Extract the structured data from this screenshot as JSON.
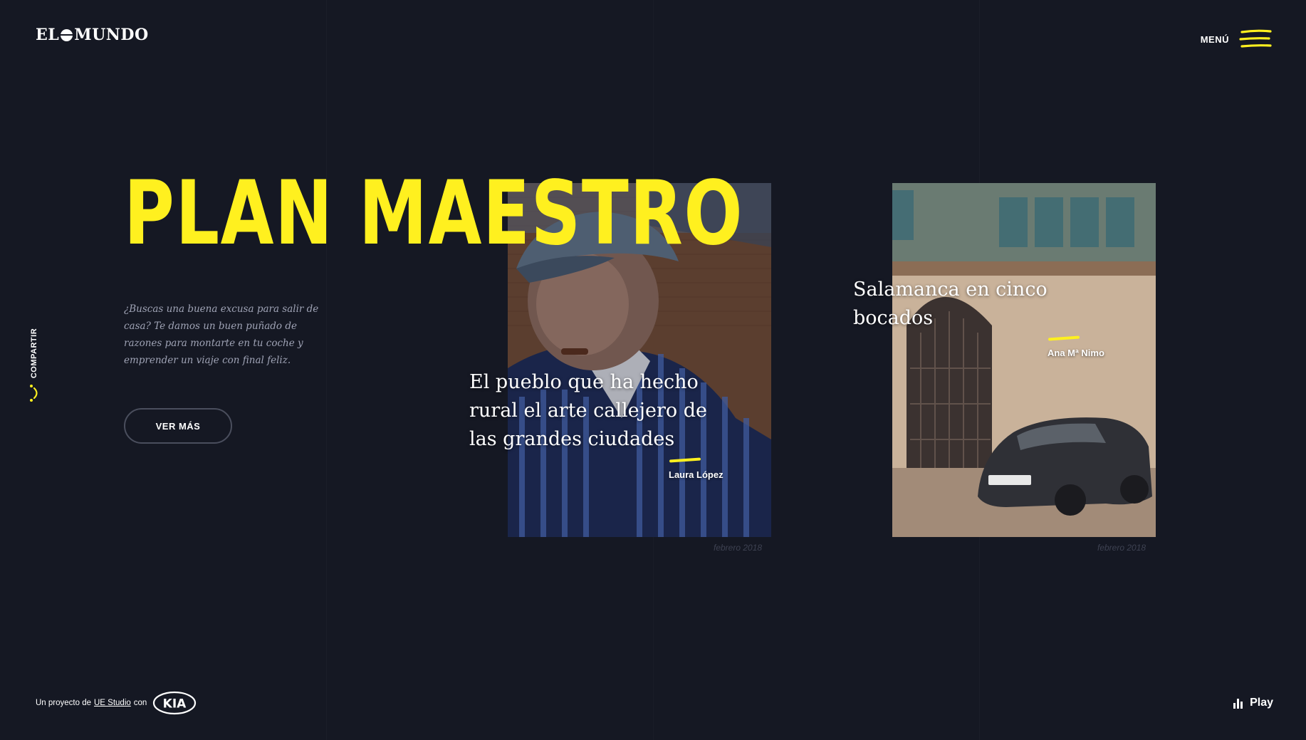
{
  "header": {
    "logo_text_left": "EL",
    "logo_text_right": "MUNDO",
    "menu_label": "MENÚ"
  },
  "share": {
    "label": "COMPARTIR"
  },
  "hero": {
    "title": "PLAN MAESTRO",
    "description": "¿Buscas una buena excusa para salir de casa? Te damos un buen puñado de razones para montarte en tu coche y emprender un viaje con final feliz.",
    "cta_label": "VER MÁS"
  },
  "cards": [
    {
      "title": "El pueblo que ha hecho rural el arte callejero de las grandes ciudades",
      "author": "Laura López",
      "date": "febrero 2018",
      "image": "mural-old-man-with-cap-icon"
    },
    {
      "title": "Salamanca en cinco bocados",
      "author": "Ana Mª Nimo",
      "date": "febrero 2018",
      "image": "historic-building-with-kia-car-icon"
    }
  ],
  "footer": {
    "credit_prefix": "Un proyecto de",
    "credit_link": "UE Studio",
    "credit_suffix": "con",
    "brand": "KIA",
    "play_label": "Play"
  },
  "colors": {
    "background": "#151823",
    "accent": "#fff01f",
    "text": "#ffffff",
    "muted": "#9fa3b5"
  }
}
